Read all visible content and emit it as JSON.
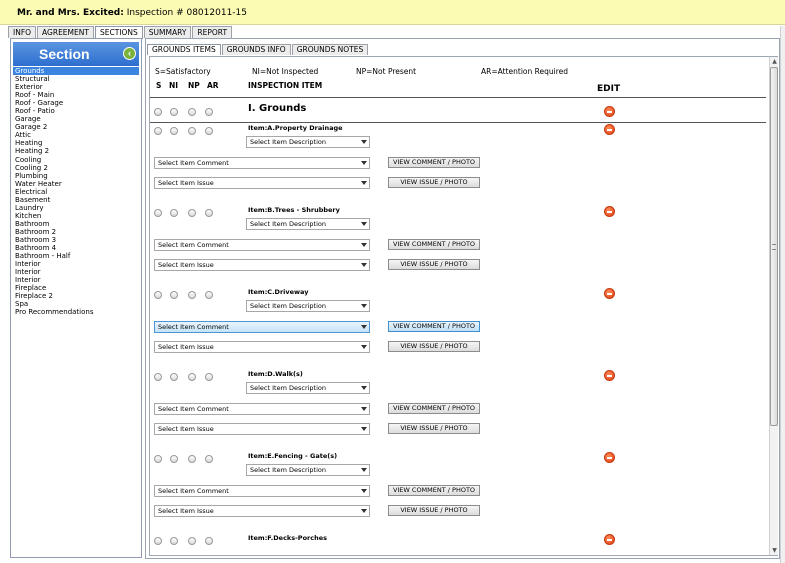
{
  "title": {
    "client": "Mr. and Mrs. Excited:",
    "inspection": "Inspection # 08012011-15"
  },
  "main_tabs": [
    "INFO",
    "AGREEMENT",
    "SECTIONS",
    "SUMMARY",
    "REPORT"
  ],
  "sidebar": {
    "header": "Section",
    "items": [
      "Grounds",
      "Structural",
      "Exterior",
      "Roof - Main",
      "Roof - Garage",
      "Roof - Patio",
      "Garage",
      "Garage 2",
      "Attic",
      "Heating",
      "Heating 2",
      "Cooling",
      "Cooling 2",
      "Plumbing",
      "Water Heater",
      "Electrical",
      "Basement",
      "Laundry",
      "Kitchen",
      "Bathroom",
      "Bathroom 2",
      "Bathroom 3",
      "Bathroom 4",
      "Bathroom - Half",
      "Interior",
      "Interior",
      "Interior",
      "Fireplace",
      "Fireplace 2",
      "Spa",
      "Pro Recommendations"
    ]
  },
  "inner_tabs": [
    "GROUNDS ITEMS",
    "GROUNDS INFO",
    "GROUNDS NOTES"
  ],
  "legend": {
    "s": "S=Satisfactory",
    "ni": "NI=Not Inspected",
    "np": "NP=Not Present",
    "ar": "AR=Attention Required"
  },
  "columns": {
    "s": "S",
    "ni": "NI",
    "np": "NP",
    "ar": "AR",
    "item": "INSPECTION ITEM",
    "edit": "EDIT"
  },
  "group_title": "I. Grounds",
  "controls": {
    "description": "Select Item Description",
    "comment": "Select Item Comment",
    "issue": "Select Item Issue",
    "view_comment": "VIEW COMMENT / PHOTO",
    "view_issue": "VIEW ISSUE / PHOTO"
  },
  "items": [
    {
      "label": "Item:A.Property Drainage"
    },
    {
      "label": "Item:B.Trees - Shrubbery"
    },
    {
      "label": "Item:C.Driveway"
    },
    {
      "label": "Item:D.Walk(s)"
    },
    {
      "label": "Item:E.Fencing - Gate(s)"
    },
    {
      "label": "Item:F.Decks-Porches"
    }
  ]
}
